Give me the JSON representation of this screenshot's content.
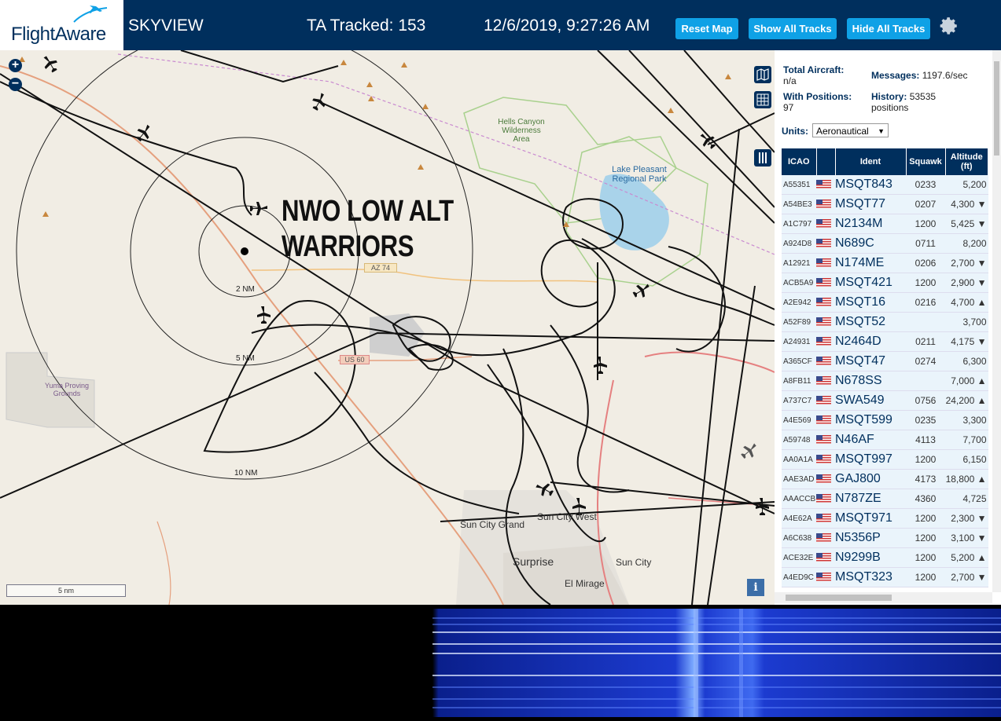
{
  "header": {
    "logo_text": "FlightAware",
    "app_title": "SKYVIEW",
    "tracked": "TA Tracked: 153",
    "datetime": "12/6/2019, 9:27:26 AM",
    "reset_map": "Reset Map",
    "show_all_tracks": "Show All Tracks",
    "hide_all_tracks": "Hide All Tracks",
    "settings_icon": "gear-icon"
  },
  "map": {
    "overlay_text_line1": "NWO LOW ALT",
    "overlay_text_line2": "WARRIORS",
    "ring_labels": [
      "2 NM",
      "5 NM",
      "10 NM"
    ],
    "places": {
      "hells_canyon": "Hells Canyon Wilderness Area",
      "lake_pleasant": "Lake Pleasant Regional Park",
      "yuma": "Yuma Proving Grounds",
      "sun_city_grand": "Sun City Grand",
      "sun_city_west": "Sun City West",
      "surprise": "Surprise",
      "sun_city": "Sun City",
      "el_mirage": "El Mirage",
      "az74": "AZ 74",
      "us60": "US 60"
    },
    "scale_label": "5 nm",
    "info_label": "i"
  },
  "stats": {
    "total_aircraft_label": "Total Aircraft:",
    "total_aircraft_value": "n/a",
    "with_positions_label": "With Positions:",
    "with_positions_value": "97",
    "messages_label": "Messages:",
    "messages_value": "1197.6/sec",
    "history_label": "History:",
    "history_value": "53535 positions"
  },
  "units": {
    "label": "Units:",
    "selected": "Aeronautical"
  },
  "table": {
    "headers": {
      "icao": "ICAO",
      "ident": "Ident",
      "squawk": "Squawk",
      "altitude": "Altitude (ft)"
    },
    "rows": [
      {
        "icao": "A55351",
        "ident": "MSQT843",
        "squawk": "0233",
        "alt": "5,200"
      },
      {
        "icao": "A54BE3",
        "ident": "MSQT77",
        "squawk": "0207",
        "alt": "4,300 ▼"
      },
      {
        "icao": "A1C797",
        "ident": "N2134M",
        "squawk": "1200",
        "alt": "5,425 ▼"
      },
      {
        "icao": "A924D8",
        "ident": "N689C",
        "squawk": "0711",
        "alt": "8,200"
      },
      {
        "icao": "A12921",
        "ident": "N174ME",
        "squawk": "0206",
        "alt": "2,700 ▼"
      },
      {
        "icao": "ACB5A9",
        "ident": "MSQT421",
        "squawk": "1200",
        "alt": "2,900 ▼"
      },
      {
        "icao": "A2E942",
        "ident": "MSQT16",
        "squawk": "0216",
        "alt": "4,700 ▲"
      },
      {
        "icao": "A52F89",
        "ident": "MSQT52",
        "squawk": "",
        "alt": "3,700"
      },
      {
        "icao": "A24931",
        "ident": "N2464D",
        "squawk": "0211",
        "alt": "4,175 ▼"
      },
      {
        "icao": "A365CF",
        "ident": "MSQT47",
        "squawk": "0274",
        "alt": "6,300"
      },
      {
        "icao": "A8FB11",
        "ident": "N678SS",
        "squawk": "",
        "alt": "7,000 ▲"
      },
      {
        "icao": "A737C7",
        "ident": "SWA549",
        "squawk": "0756",
        "alt": "24,200 ▲"
      },
      {
        "icao": "A4E569",
        "ident": "MSQT599",
        "squawk": "0235",
        "alt": "3,300"
      },
      {
        "icao": "A59748",
        "ident": "N46AF",
        "squawk": "4113",
        "alt": "7,700"
      },
      {
        "icao": "AA0A1A",
        "ident": "MSQT997",
        "squawk": "1200",
        "alt": "6,150"
      },
      {
        "icao": "AAE3AD",
        "ident": "GAJ800",
        "squawk": "4173",
        "alt": "18,800 ▲"
      },
      {
        "icao": "AAACCB",
        "ident": "N787ZE",
        "squawk": "4360",
        "alt": "4,725"
      },
      {
        "icao": "A4E62A",
        "ident": "MSQT971",
        "squawk": "1200",
        "alt": "2,300 ▼"
      },
      {
        "icao": "A6C638",
        "ident": "N5356P",
        "squawk": "1200",
        "alt": "3,100 ▼"
      },
      {
        "icao": "ACE32E",
        "ident": "N9299B",
        "squawk": "1200",
        "alt": "5,200 ▲"
      },
      {
        "icao": "A4ED9C",
        "ident": "MSQT323",
        "squawk": "1200",
        "alt": "2,700 ▼"
      }
    ]
  },
  "colors": {
    "navy": "#002f5d",
    "button": "#0fa1e6",
    "map_bg": "#f1ede4",
    "water": "#a9d3ea"
  }
}
